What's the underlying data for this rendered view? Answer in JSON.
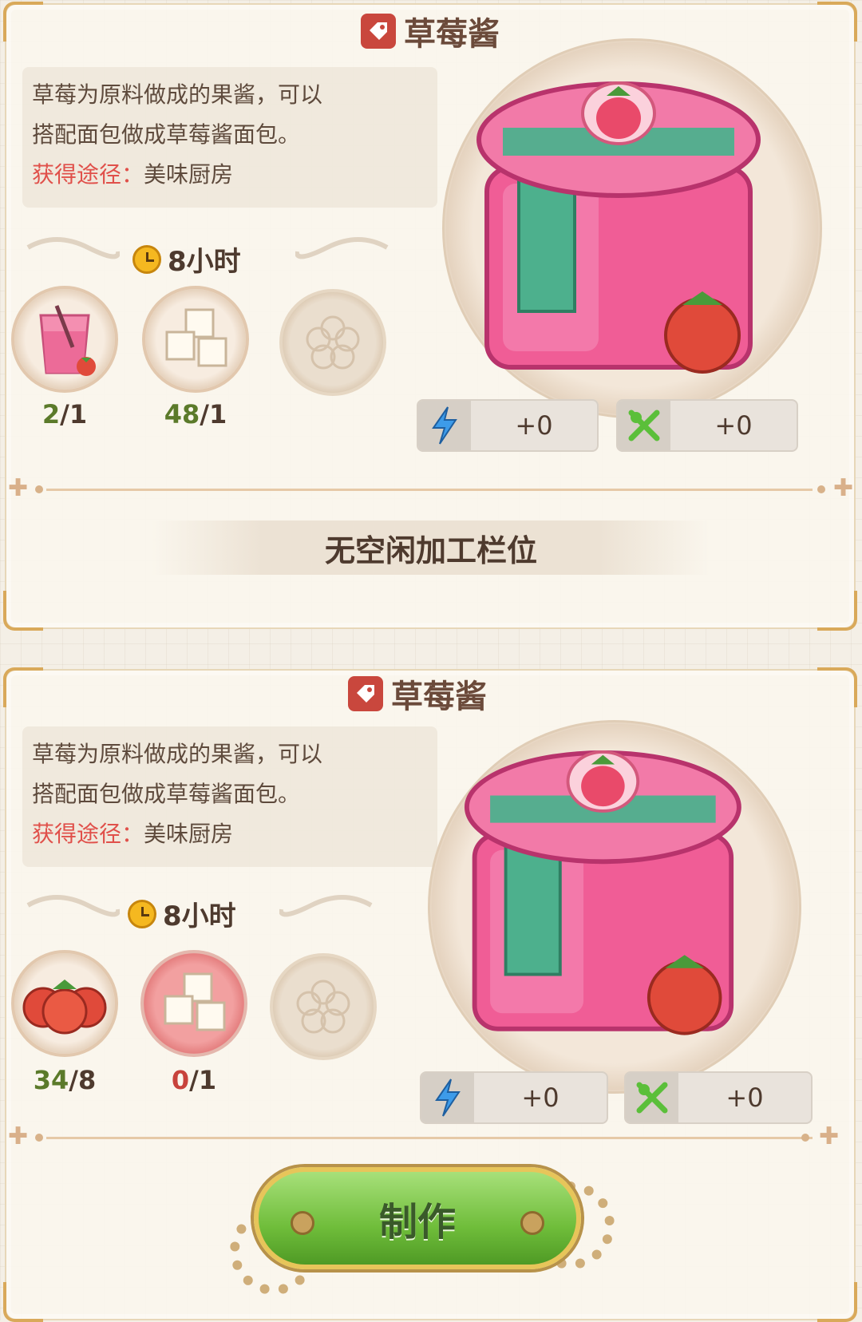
{
  "recipes": [
    {
      "title": "草莓酱",
      "desc_line1": "草莓为原料做成的果酱，可以",
      "desc_line2": "搭配面包做成草莓酱面包。",
      "source_label": "获得途径：",
      "source_value": "美味厨房",
      "time": "8小时",
      "ingredients": [
        {
          "icon": "pink-drink-icon",
          "have": "2",
          "need": "/1"
        },
        {
          "icon": "sugar-cubes-icon",
          "have": "48",
          "need": "/1"
        },
        {
          "icon": "empty-slot-icon"
        }
      ],
      "energy": "+0",
      "food": "+0"
    },
    {
      "title": "草莓酱",
      "desc_line1": "草莓为原料做成的果酱，可以",
      "desc_line2": "搭配面包做成草莓酱面包。",
      "source_label": "获得途径：",
      "source_value": "美味厨房",
      "time": "8小时",
      "ingredients": [
        {
          "icon": "strawberries-icon",
          "have": "34",
          "need": "/8"
        },
        {
          "icon": "sugar-cubes-icon",
          "have": "0",
          "need": "/1"
        },
        {
          "icon": "empty-slot-icon"
        }
      ],
      "energy": "+0",
      "food": "+0"
    }
  ],
  "status_banner": "无空闲加工栏位",
  "make_button": "制作",
  "colors": {
    "accent_red": "#c9473d",
    "button_green": "#6fbd3a",
    "source_red": "#e0504a"
  }
}
